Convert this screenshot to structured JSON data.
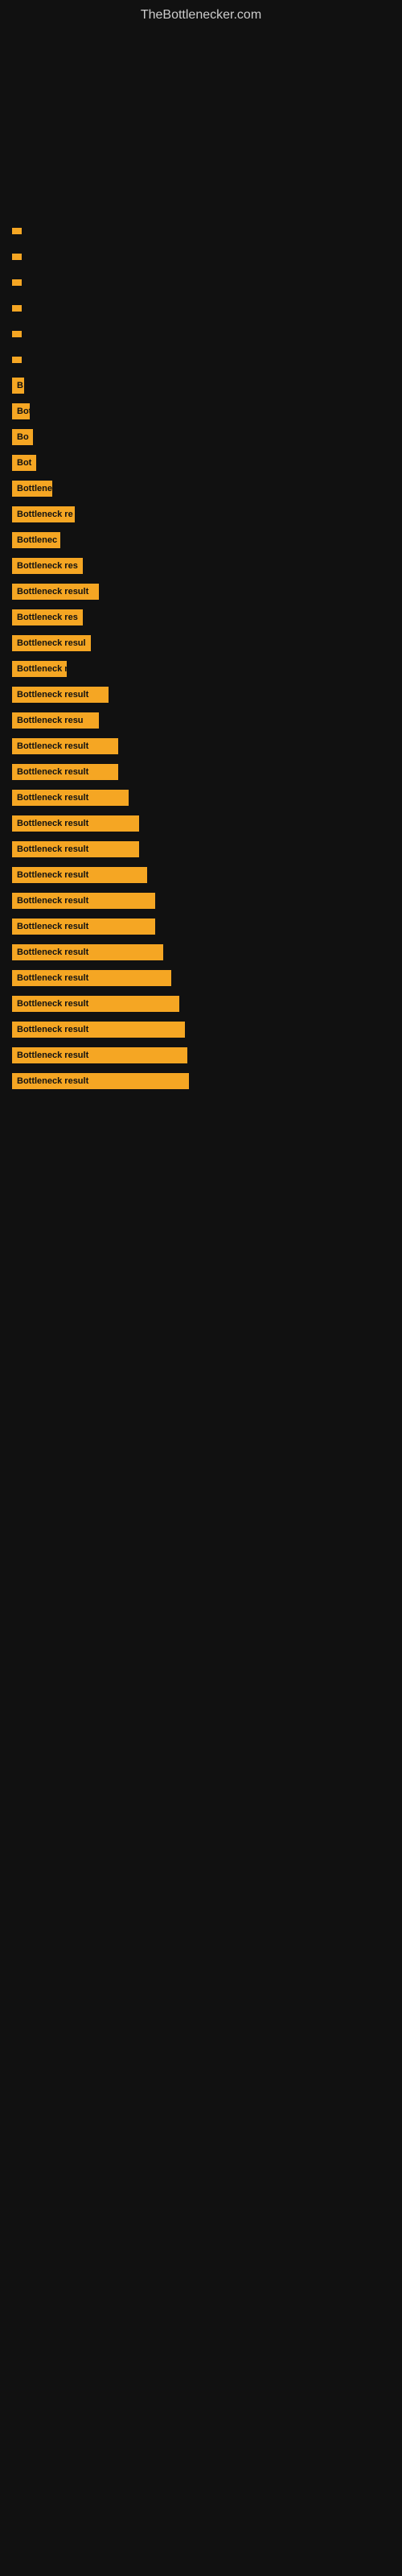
{
  "site": {
    "title": "TheBottlenecker.com"
  },
  "results": [
    {
      "id": 1,
      "label": "",
      "width_class": "bar-w-5"
    },
    {
      "id": 2,
      "label": "",
      "width_class": "bar-w-5"
    },
    {
      "id": 3,
      "label": "",
      "width_class": "bar-w-8"
    },
    {
      "id": 4,
      "label": "",
      "width_class": "bar-w-8"
    },
    {
      "id": 5,
      "label": "",
      "width_class": "bar-w-10"
    },
    {
      "id": 6,
      "label": "",
      "width_class": "bar-w-12"
    },
    {
      "id": 7,
      "label": "B",
      "width_class": "bar-w-15"
    },
    {
      "id": 8,
      "label": "Bot",
      "width_class": "bar-w-22"
    },
    {
      "id": 9,
      "label": "Bo",
      "width_class": "bar-w-26"
    },
    {
      "id": 10,
      "label": "Bot",
      "width_class": "bar-w-30"
    },
    {
      "id": 11,
      "label": "Bottlene",
      "width_class": "bar-w-50"
    },
    {
      "id": 12,
      "label": "Bottleneck re",
      "width_class": "bar-w-78"
    },
    {
      "id": 13,
      "label": "Bottlenec",
      "width_class": "bar-w-60"
    },
    {
      "id": 14,
      "label": "Bottleneck res",
      "width_class": "bar-w-88"
    },
    {
      "id": 15,
      "label": "Bottleneck result",
      "width_class": "bar-w-108"
    },
    {
      "id": 16,
      "label": "Bottleneck res",
      "width_class": "bar-w-88"
    },
    {
      "id": 17,
      "label": "Bottleneck resul",
      "width_class": "bar-w-98"
    },
    {
      "id": 18,
      "label": "Bottleneck r",
      "width_class": "bar-w-68"
    },
    {
      "id": 19,
      "label": "Bottleneck result",
      "width_class": "bar-w-120"
    },
    {
      "id": 20,
      "label": "Bottleneck resu",
      "width_class": "bar-w-108"
    },
    {
      "id": 21,
      "label": "Bottleneck result",
      "width_class": "bar-w-132"
    },
    {
      "id": 22,
      "label": "Bottleneck result",
      "width_class": "bar-w-132"
    },
    {
      "id": 23,
      "label": "Bottleneck result",
      "width_class": "bar-w-145"
    },
    {
      "id": 24,
      "label": "Bottleneck result",
      "width_class": "bar-w-158"
    },
    {
      "id": 25,
      "label": "Bottleneck result",
      "width_class": "bar-w-158"
    },
    {
      "id": 26,
      "label": "Bottleneck result",
      "width_class": "bar-w-168"
    },
    {
      "id": 27,
      "label": "Bottleneck result",
      "width_class": "bar-w-178"
    },
    {
      "id": 28,
      "label": "Bottleneck result",
      "width_class": "bar-w-178"
    },
    {
      "id": 29,
      "label": "Bottleneck result",
      "width_class": "bar-w-188"
    },
    {
      "id": 30,
      "label": "Bottleneck result",
      "width_class": "bar-w-198"
    },
    {
      "id": 31,
      "label": "Bottleneck result",
      "width_class": "bar-w-208"
    },
    {
      "id": 32,
      "label": "Bottleneck result",
      "width_class": "bar-w-215"
    },
    {
      "id": 33,
      "label": "Bottleneck result",
      "width_class": "bar-w-218"
    },
    {
      "id": 34,
      "label": "Bottleneck result",
      "width_class": "bar-w-220"
    }
  ]
}
